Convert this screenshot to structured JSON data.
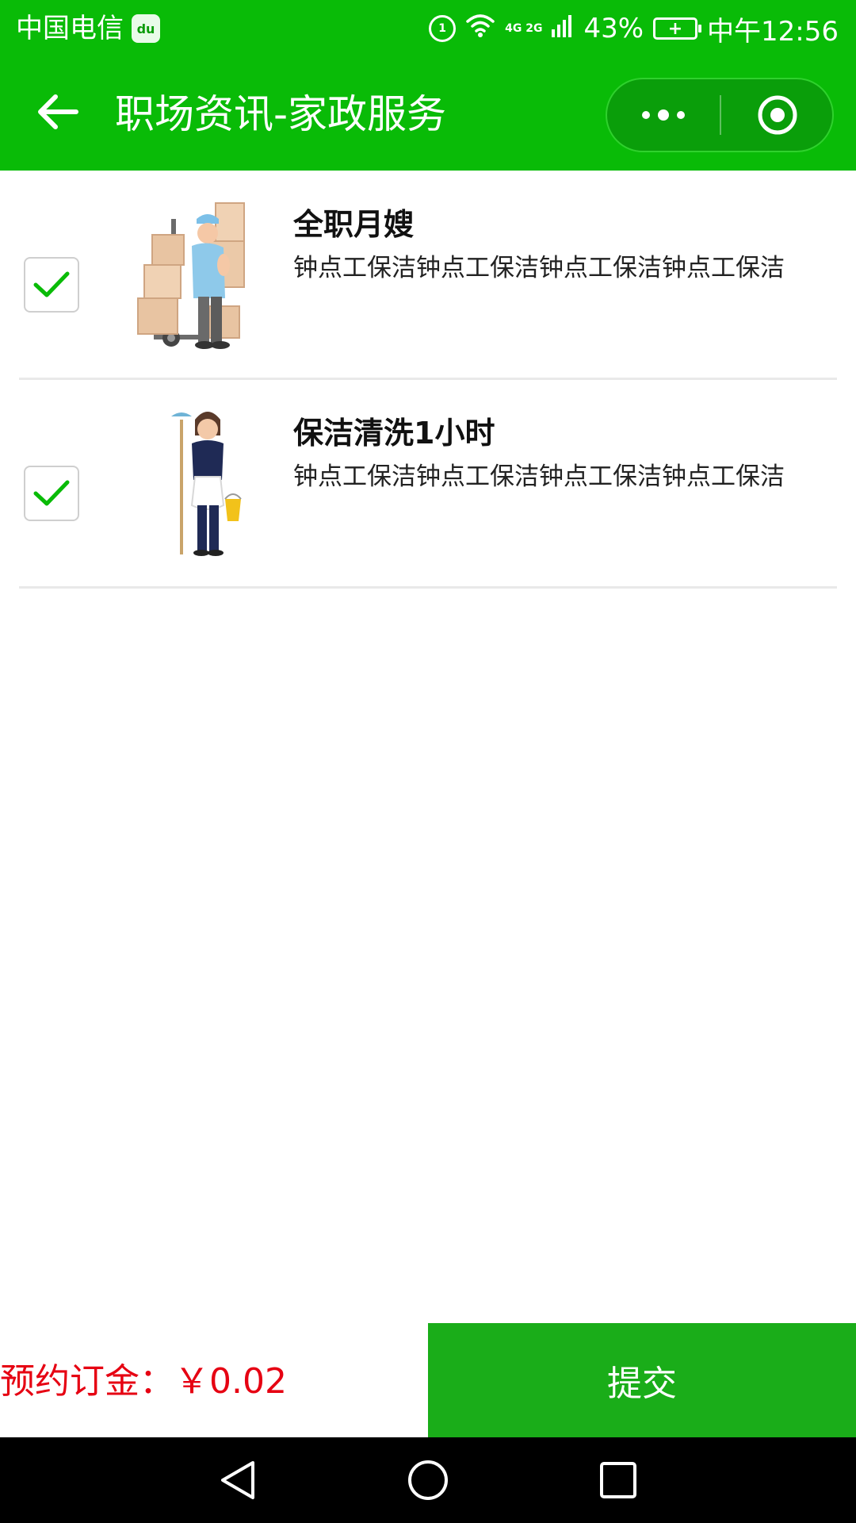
{
  "status_bar": {
    "carrier": "中国电信",
    "baidu_icon_text": "du",
    "sim_icon_text": "1",
    "network": "4G 2G",
    "battery_percent": "43%",
    "time": "中午12:56"
  },
  "nav": {
    "title": "职场资讯-家政服务",
    "icons": {
      "back": "arrow-left-icon",
      "more": "more-dots-icon",
      "close": "target-circle-icon"
    }
  },
  "items": [
    {
      "title": "全职月嫂",
      "desc": "钟点工保洁钟点工保洁钟点工保洁钟点工保洁",
      "checked": true,
      "image": "delivery-man-with-boxes"
    },
    {
      "title": "保洁清洗1小时",
      "desc": "钟点工保洁钟点工保洁钟点工保洁钟点工保洁",
      "checked": true,
      "image": "cleaning-woman-with-mop"
    }
  ],
  "footer": {
    "deposit_label": "预约订金：￥0.02",
    "submit_label": "提交"
  },
  "colors": {
    "header_green": "#09bb07",
    "button_green": "#1aad19",
    "price_red": "#e60012",
    "check_green": "#09bb07"
  }
}
